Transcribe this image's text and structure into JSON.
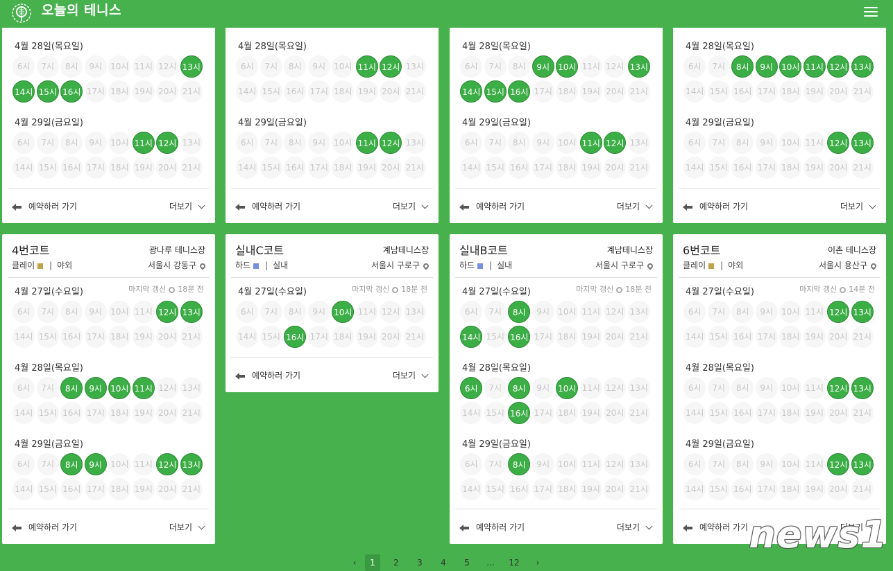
{
  "app": {
    "title": "오늘의 테니스"
  },
  "common": {
    "book_label": "예약하러 가기",
    "more_label": "더보기",
    "updated_prefix": "마지막 갱신"
  },
  "hours": [
    "6시",
    "7시",
    "8시",
    "9시",
    "10시",
    "11시",
    "12시",
    "13시",
    "14시",
    "15시",
    "16시",
    "17시",
    "18시",
    "19시",
    "20시",
    "21시"
  ],
  "top_cards": [
    {
      "days": [
        {
          "label": "4월 28일(목요일)",
          "available": [
            "13시",
            "14시",
            "15시",
            "16시"
          ]
        },
        {
          "label": "4월 29일(금요일)",
          "available": [
            "11시",
            "12시"
          ]
        }
      ]
    },
    {
      "days": [
        {
          "label": "4월 28일(목요일)",
          "available": [
            "11시",
            "12시"
          ]
        },
        {
          "label": "4월 29일(금요일)",
          "available": [
            "11시",
            "12시"
          ]
        }
      ]
    },
    {
      "days": [
        {
          "label": "4월 28일(목요일)",
          "available": [
            "9시",
            "10시",
            "13시",
            "14시",
            "15시",
            "16시"
          ]
        },
        {
          "label": "4월 29일(금요일)",
          "available": [
            "11시",
            "12시"
          ]
        }
      ]
    },
    {
      "days": [
        {
          "label": "4월 28일(목요일)",
          "available": [
            "8시",
            "9시",
            "10시",
            "11시",
            "12시",
            "13시"
          ]
        },
        {
          "label": "4월 29일(금요일)",
          "available": [
            "12시",
            "13시"
          ]
        }
      ]
    }
  ],
  "bottom_cards": [
    {
      "name": "4번코트",
      "venue": "광나루 테니스장",
      "surface": "클레이",
      "surface_color": "#bfa24a",
      "setting": "야외",
      "district": "서울시 강동구",
      "updated": "18분 전",
      "days": [
        {
          "label": "4월 27일(수요일)",
          "available": [
            "12시",
            "13시"
          ]
        },
        {
          "label": "4월 28일(목요일)",
          "available": [
            "8시",
            "9시",
            "10시",
            "11시"
          ]
        },
        {
          "label": "4월 29일(금요일)",
          "available": [
            "8시",
            "9시",
            "12시",
            "13시"
          ]
        }
      ]
    },
    {
      "name": "실내C코트",
      "venue": "계남테니스장",
      "surface": "하드",
      "surface_color": "#7b8fe0",
      "setting": "실내",
      "district": "서울시 구로구",
      "updated": "18분 전",
      "days": [
        {
          "label": "4월 27일(수요일)",
          "available": [
            "10시",
            "16시"
          ]
        }
      ]
    },
    {
      "name": "실내B코트",
      "venue": "계남테니스장",
      "surface": "하드",
      "surface_color": "#7b8fe0",
      "setting": "실내",
      "district": "서울시 구로구",
      "updated": "18분 전",
      "days": [
        {
          "label": "4월 27일(수요일)",
          "available": [
            "8시",
            "14시",
            "16시"
          ]
        },
        {
          "label": "4월 28일(목요일)",
          "available": [
            "6시",
            "8시",
            "10시",
            "16시"
          ]
        },
        {
          "label": "4월 29일(금요일)",
          "available": [
            "8시"
          ]
        }
      ]
    },
    {
      "name": "6번코트",
      "venue": "이촌 테니스장",
      "surface": "클레이",
      "surface_color": "#bfa24a",
      "setting": "야외",
      "district": "서울시 용산구",
      "updated": "14분 전",
      "days": [
        {
          "label": "4월 27일(수요일)",
          "available": [
            "12시",
            "13시"
          ]
        },
        {
          "label": "4월 28일(목요일)",
          "available": [
            "12시",
            "13시"
          ]
        },
        {
          "label": "4월 29일(금요일)",
          "available": [
            "12시",
            "13시"
          ]
        }
      ]
    }
  ],
  "pagination": {
    "prev": "‹",
    "pages": [
      "1",
      "2",
      "3",
      "4",
      "5",
      "...",
      "12"
    ],
    "current": "1",
    "next": "›"
  },
  "watermark": "news1"
}
